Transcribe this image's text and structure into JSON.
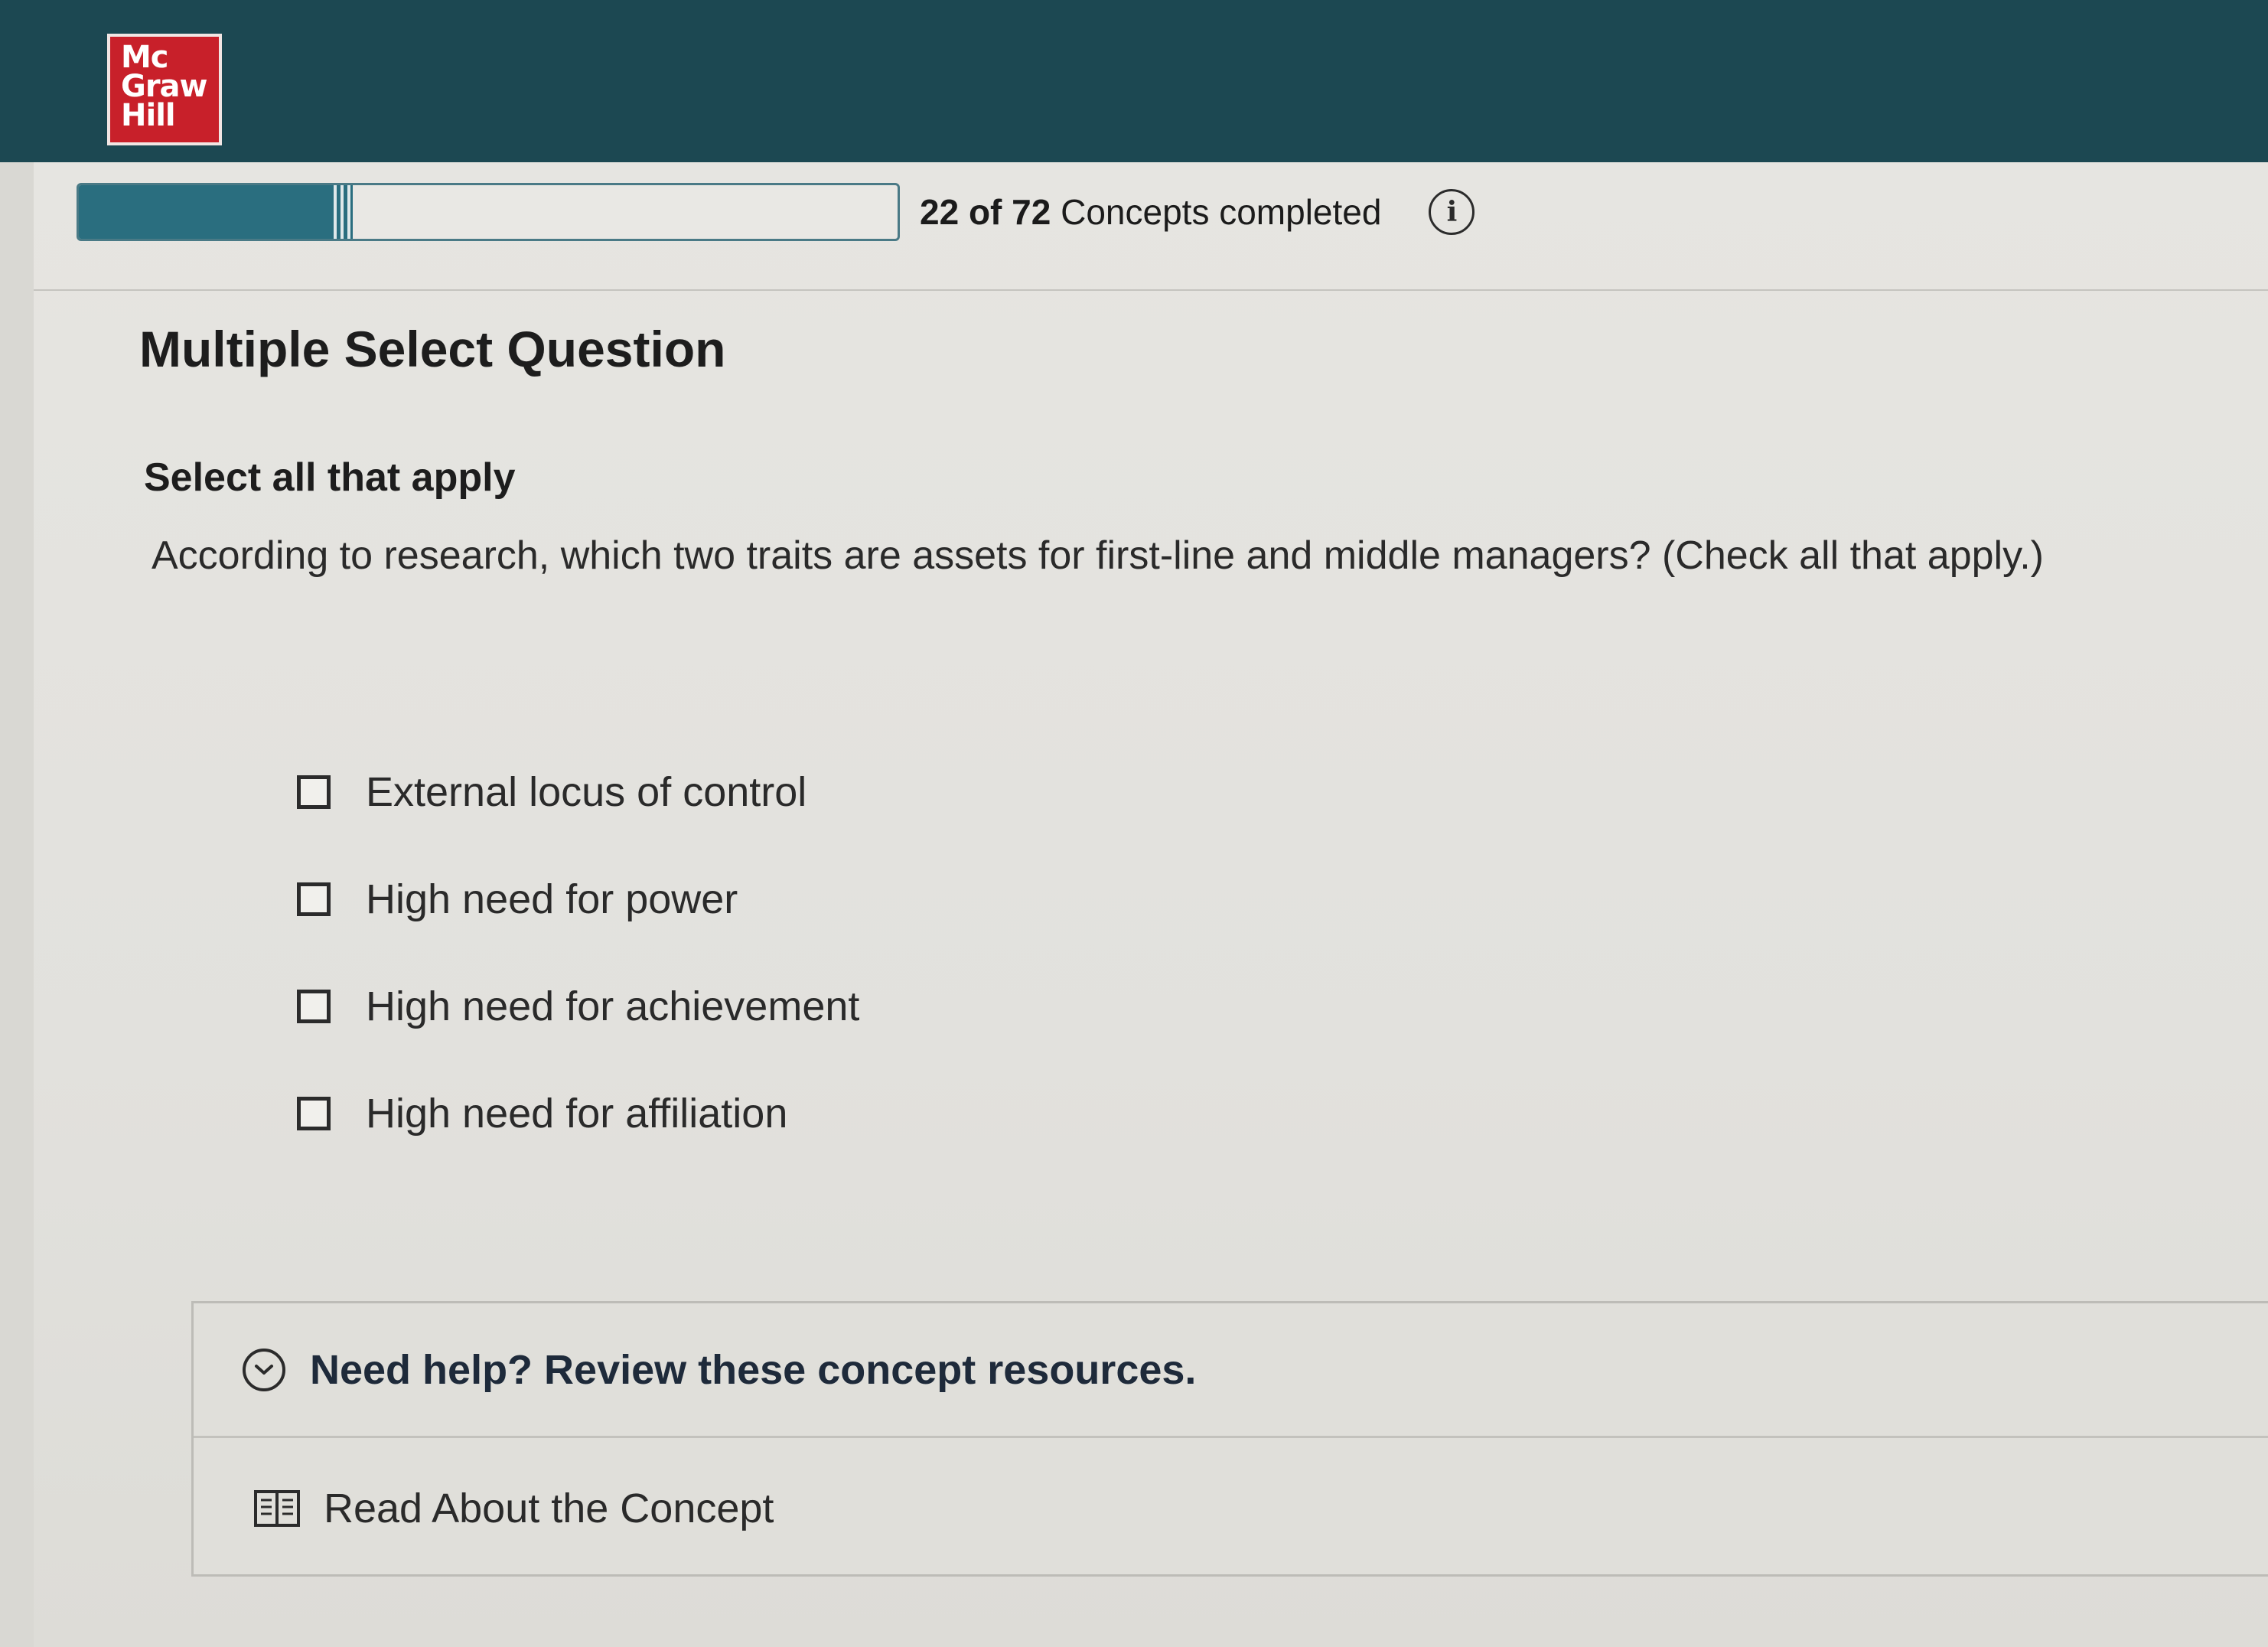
{
  "brand": {
    "logo_lines": [
      "Mc",
      "Graw",
      "Hill"
    ],
    "bar_color": "#1c4852",
    "logo_color": "#c8202a"
  },
  "progress": {
    "completed": "22",
    "of_word": "of",
    "total": "72",
    "suffix": "Concepts completed",
    "fraction": 0.31,
    "accent_color": "#2a6e7f",
    "info_icon": "info-icon"
  },
  "question": {
    "type_label": "Multiple Select Question",
    "instruction": "Select all that apply",
    "prompt": "According to research, which two traits are assets for first-line and middle managers? (Check all that apply.)",
    "options": [
      {
        "label": "External locus of control",
        "checked": false
      },
      {
        "label": "High need for power",
        "checked": false
      },
      {
        "label": "High need for achievement",
        "checked": false
      },
      {
        "label": "High need for affiliation",
        "checked": false
      }
    ]
  },
  "help": {
    "title": "Need help? Review these concept resources.",
    "toggle_icon": "chevron-down-icon",
    "resources": [
      {
        "label": "Read About the Concept",
        "icon": "book-icon"
      }
    ]
  }
}
